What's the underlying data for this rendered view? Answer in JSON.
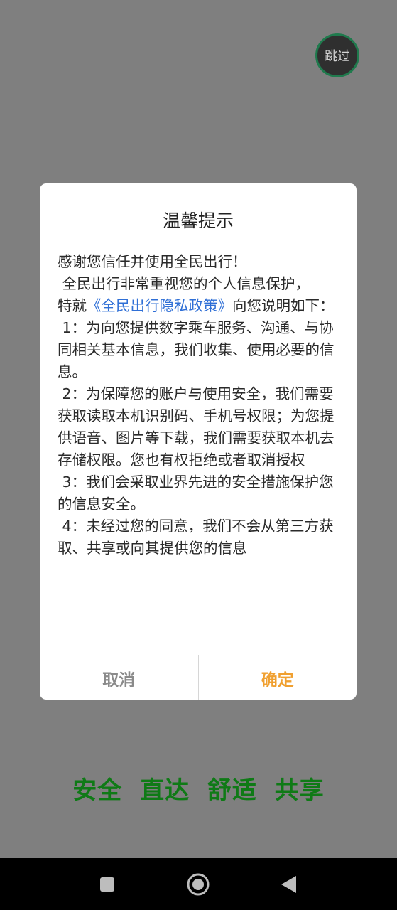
{
  "skip": {
    "label": "跳过"
  },
  "dialog": {
    "title": "温馨提示",
    "greeting": "感谢您信任并使用全民出行！",
    "intro_line": " 全民出行非常重视您的个人信息保护，",
    "intro_prefix": "特就",
    "policy_link": "《全民出行隐私政策》",
    "intro_suffix": "向您说明如下：",
    "items": [
      " 1：为向您提供数字乘车服务、沟通、与协同相关基本信息，我们收集、使用必要的信息。",
      " 2：为保障您的账户与使用安全，我们需要获取读取本机识别码、手机号权限；为您提供语音、图片等下载，我们需要获取本机去存储权限。您也有权拒绝或者取消授权",
      " 3：我们会采取业界先进的安全措施保护您的信息安全。",
      " 4：未经过您的同意，我们不会从第三方获取、共享或向其提供您的信息"
    ],
    "cancel_label": "取消",
    "confirm_label": "确定"
  },
  "slogan": "安全 直达 舒适 共享",
  "colors": {
    "overlay": "#7f7f7f",
    "link": "#2f6fd6",
    "confirm": "#f0a030",
    "slogan": "#0f7a16",
    "skip_border": "#1f7a4d"
  },
  "navbar": {
    "icons": [
      "recents-icon",
      "home-icon",
      "back-icon"
    ]
  }
}
